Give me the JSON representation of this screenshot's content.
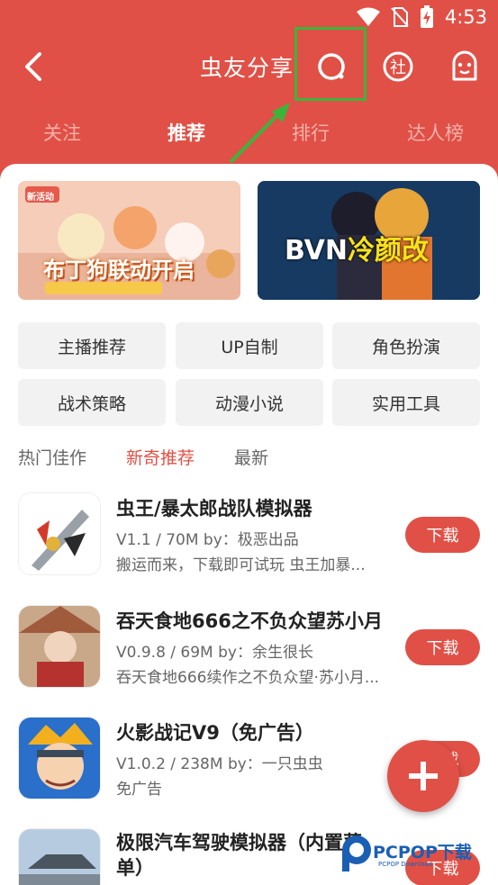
{
  "status_bar": {
    "time": "4:53"
  },
  "header": {
    "title": "虫友分享"
  },
  "tabs": [
    {
      "label": "关注",
      "active": false
    },
    {
      "label": "推荐",
      "active": true
    },
    {
      "label": "排行",
      "active": false
    },
    {
      "label": "达人榜",
      "active": false
    }
  ],
  "banners": [
    {
      "text": "布丁狗联动开启",
      "badge": "新活动"
    },
    {
      "text_white": "BVN",
      "text_yellow": "冷颜改"
    }
  ],
  "categories": [
    "主播推荐",
    "UP自制",
    "角色扮演",
    "战术策略",
    "动漫小说",
    "实用工具"
  ],
  "subtabs": [
    {
      "label": "热门佳作",
      "active": false
    },
    {
      "label": "新奇推荐",
      "active": true
    },
    {
      "label": "最新",
      "active": false
    }
  ],
  "apps": [
    {
      "name": "虫王/暴太郎战队模拟器",
      "meta": "V1.1 / 70M  by：极恶出品",
      "desc": "搬运而来，下载即可试玩 虫王加暴...",
      "button": "下载"
    },
    {
      "name": "吞天食地666之不负众望苏小月",
      "meta": "V0.9.8 / 69M  by：余生很长",
      "desc": "吞天食地666续作之不负众望·苏小月...",
      "button": "下载"
    },
    {
      "name": "火影战记V9（免广告）",
      "meta": "V1.0.2 / 238M  by：一只虫虫",
      "desc": "免广告",
      "button": "下载"
    },
    {
      "name": "极限汽车驾驶模拟器（内置菜单）",
      "meta": "",
      "desc": "",
      "button": "下载"
    }
  ],
  "watermark": {
    "brand": "PCPOP下载",
    "sub": "PCPOP Download"
  },
  "colors": {
    "accent": "#e05046",
    "highlight": "#3cb43c"
  }
}
